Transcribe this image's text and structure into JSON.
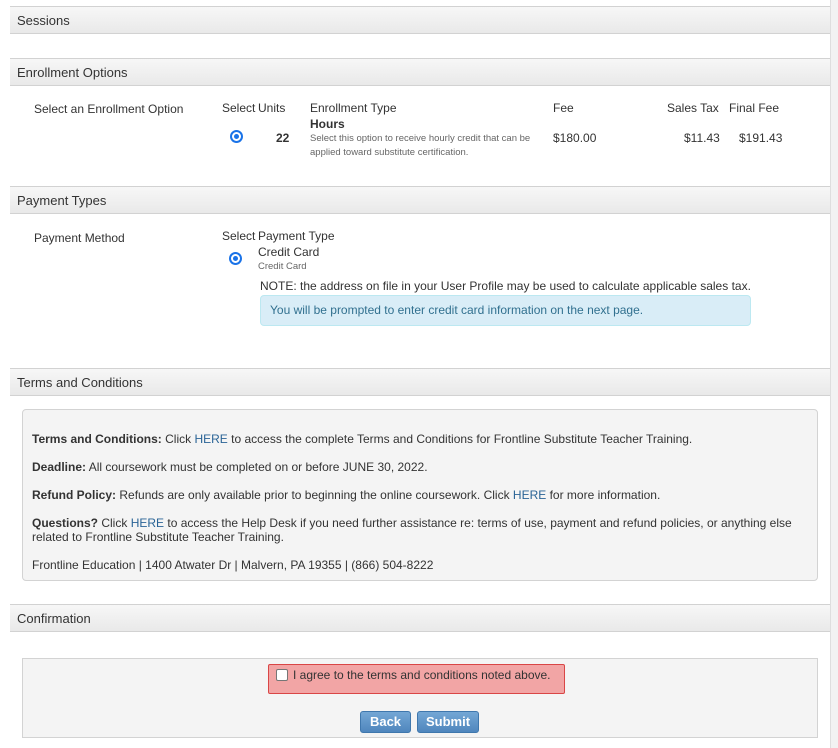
{
  "sections": {
    "sessions": "Sessions",
    "enrollment": "Enrollment Options",
    "payment": "Payment Types",
    "terms": "Terms and Conditions",
    "confirmation": "Confirmation"
  },
  "enrollment": {
    "label": "Select an Enrollment Option",
    "headers": {
      "select": "Select",
      "units": "Units",
      "type": "Enrollment Type",
      "fee": "Fee",
      "sales_tax": "Sales Tax",
      "final_fee": "Final Fee"
    },
    "option": {
      "units": "22",
      "type_title": "Hours",
      "type_desc_line1": "Select this option to receive hourly credit that can be",
      "type_desc_line2": "applied toward substitute certification.",
      "fee": "$180.00",
      "sales_tax": "$11.43",
      "final_fee": "$191.43",
      "selected": true
    }
  },
  "payment": {
    "label": "Payment Method",
    "headers": {
      "select": "Select",
      "type": "Payment Type"
    },
    "option": {
      "title": "Credit Card",
      "subtitle": "Credit Card",
      "selected": true
    },
    "note": "NOTE: the address on file in your User Profile may be used to calculate applicable sales tax.",
    "info": "You will be prompted to enter credit card information on the next page."
  },
  "terms": {
    "tc_label": "Terms and Conditions:",
    "tc_pre": " Click ",
    "tc_link": "HERE",
    "tc_post": " to access the complete Terms and Conditions for Frontline Substitute Teacher Training.",
    "deadline_label": "Deadline:",
    "deadline_text": " All coursework must be completed on or before JUNE 30, 2022.",
    "refund_label": "Refund Policy:",
    "refund_pre": " Refunds are only available prior to beginning the online coursework. Click ",
    "refund_link": "HERE",
    "refund_post": " for more information.",
    "questions_label": "Questions?",
    "questions_pre": " Click ",
    "questions_link": "HERE",
    "questions_post": " to access the Help Desk if you need further assistance re: terms of use, payment and refund policies, or anything else related to Frontline Substitute Teacher Training.",
    "address": "Frontline Education | 1400 Atwater Dr | Malvern, PA 19355 | (866) 504-8222"
  },
  "confirmation": {
    "agree_text": "I agree to the terms and conditions noted above.",
    "back_label": "Back",
    "submit_label": "Submit"
  },
  "colors": {
    "accent": "#4f86bd",
    "link": "#2a6496",
    "error_bg": "#f2a5a5",
    "info_bg": "#d9edf7"
  }
}
